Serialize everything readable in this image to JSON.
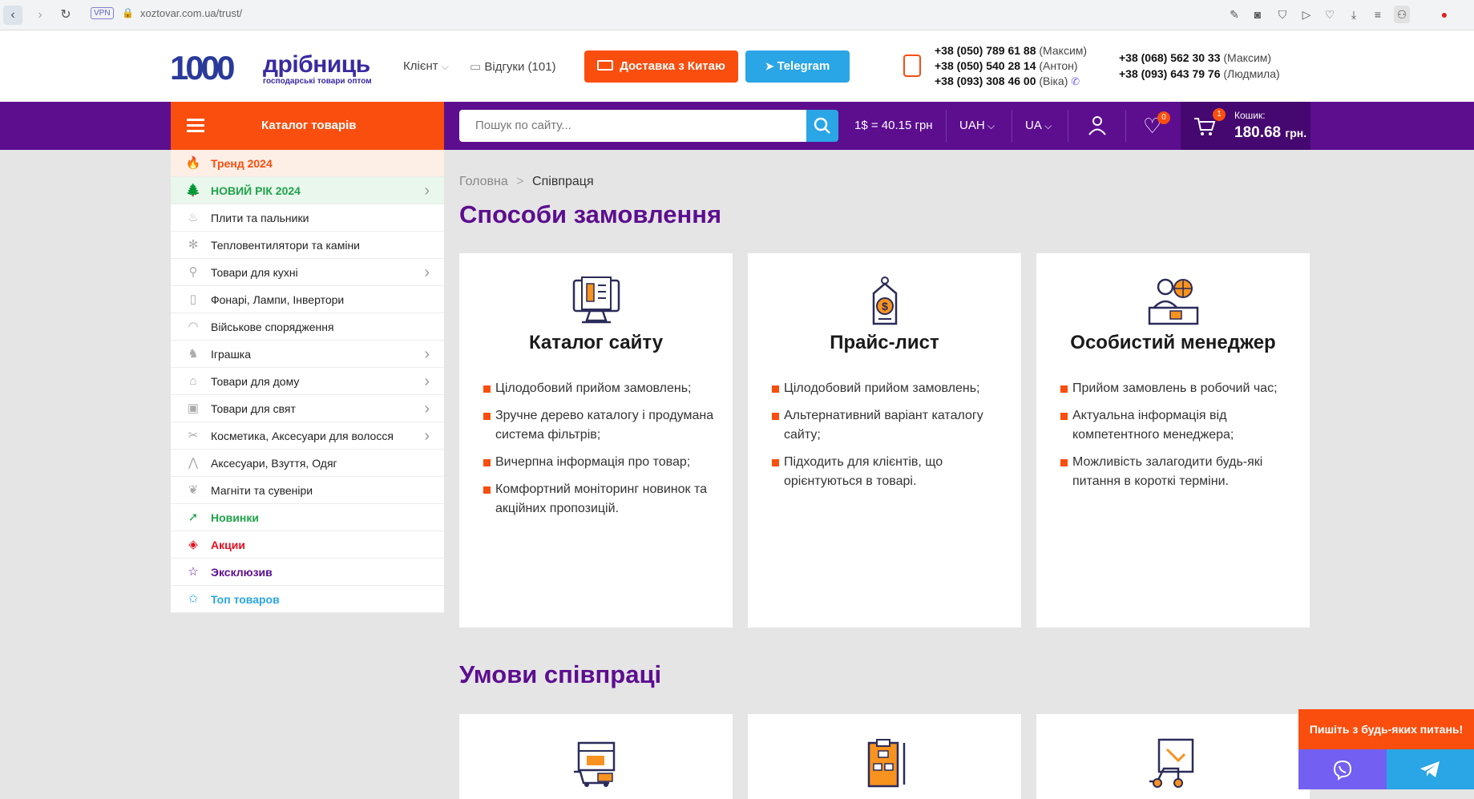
{
  "browser": {
    "url": "xoztovar.com.ua/trust/",
    "vpn_label": "VPN"
  },
  "header": {
    "logo_number": "1000",
    "logo_name": "дрібниць",
    "logo_tagline": "господарські товари оптом",
    "client_label": "Клієнт",
    "reviews_label": "Відгуки (101)",
    "china_button": "Доставка з Китаю",
    "telegram_button": "Telegram",
    "phones_left": [
      {
        "number": "+38 (050) 789 61 88",
        "name": "(Максим)"
      },
      {
        "number": "+38 (050) 540 28 14",
        "name": "(Антон)"
      },
      {
        "number": "+38 (093) 308 46 00",
        "name": "(Віка)"
      }
    ],
    "phones_right": [
      {
        "number": "+38 (068) 562 30 33",
        "name": "(Максим)"
      },
      {
        "number": "+38 (093) 643 79 76",
        "name": "(Людмила)"
      }
    ]
  },
  "navbar": {
    "catalog_label": "Каталог товарів",
    "search_placeholder": "Пошук по сайту...",
    "rate": "1$ = 40.15 грн",
    "currency": "UAH",
    "language": "UA",
    "wishlist_count": "0",
    "cart_count": "1",
    "cart_label": "Кошик:",
    "cart_total": "180.68",
    "cart_currency": "грн."
  },
  "sidebar": {
    "items": [
      {
        "label": "Тренд 2024",
        "icon": "fire-icon",
        "glyph": "🔥",
        "color": "#f94e0e",
        "bold": true,
        "bg": "#fdeee6",
        "chevron": false
      },
      {
        "label": "НОВИЙ РІК 2024",
        "icon": "tree-icon",
        "glyph": "🌲",
        "color": "#1fa34a",
        "bold": true,
        "bg": "#e9f7ec",
        "chevron": true
      },
      {
        "label": "Плити та пальники",
        "icon": "flame-icon",
        "glyph": "♨",
        "color": "#222",
        "bold": false,
        "bg": "#fff",
        "chevron": false
      },
      {
        "label": "Тепловентилятори та каміни",
        "icon": "fan-icon",
        "glyph": "✻",
        "color": "#222",
        "bold": false,
        "bg": "#fff",
        "chevron": false
      },
      {
        "label": "Товари для кухні",
        "icon": "kitchen-icon",
        "glyph": "⚲",
        "color": "#222",
        "bold": false,
        "bg": "#fff",
        "chevron": true
      },
      {
        "label": "Фонарі, Лампи, Інвертори",
        "icon": "flashlight-icon",
        "glyph": "▯",
        "color": "#222",
        "bold": false,
        "bg": "#fff",
        "chevron": false
      },
      {
        "label": "Військове спорядження",
        "icon": "helmet-icon",
        "glyph": "◠",
        "color": "#222",
        "bold": false,
        "bg": "#fff",
        "chevron": false
      },
      {
        "label": "Іграшка",
        "icon": "toy-icon",
        "glyph": "♞",
        "color": "#222",
        "bold": false,
        "bg": "#fff",
        "chevron": true
      },
      {
        "label": "Товари для дому",
        "icon": "house-icon",
        "glyph": "⌂",
        "color": "#222",
        "bold": false,
        "bg": "#fff",
        "chevron": true
      },
      {
        "label": "Товари для свят",
        "icon": "gift-icon",
        "glyph": "▣",
        "color": "#222",
        "bold": false,
        "bg": "#fff",
        "chevron": true
      },
      {
        "label": "Косметика, Аксесуари для волосся",
        "icon": "scissors-icon",
        "glyph": "✂",
        "color": "#222",
        "bold": false,
        "bg": "#fff",
        "chevron": true
      },
      {
        "label": "Аксесуари, Взуття, Одяг",
        "icon": "hanger-icon",
        "glyph": "⋀",
        "color": "#222",
        "bold": false,
        "bg": "#fff",
        "chevron": false
      },
      {
        "label": "Магніти та сувеніри",
        "icon": "souvenir-icon",
        "glyph": "❦",
        "color": "#222",
        "bold": false,
        "bg": "#fff",
        "chevron": false
      },
      {
        "label": "Новинки",
        "icon": "arrow-icon",
        "glyph": "➚",
        "color": "#1fa34a",
        "bold": true,
        "bg": "#fff",
        "chevron": false
      },
      {
        "label": "Акции",
        "icon": "tag-icon",
        "glyph": "◈",
        "color": "#e5101f",
        "bold": true,
        "bg": "#fff",
        "chevron": false
      },
      {
        "label": "Эксклюзив",
        "icon": "star-icon",
        "glyph": "☆",
        "color": "#5c0e8f",
        "bold": true,
        "bg": "#fff",
        "chevron": false
      },
      {
        "label": "Топ товаров",
        "icon": "top-star-icon",
        "glyph": "✩",
        "color": "#2aa5e5",
        "bold": true,
        "bg": "#fff",
        "chevron": false
      }
    ]
  },
  "breadcrumb": {
    "home": "Головна",
    "separator": ">",
    "current": "Співпраця"
  },
  "sections": {
    "order_methods_title": "Способи замовлення",
    "cooperation_title": "Умови співпраці"
  },
  "cards": [
    {
      "title": "Каталог сайту",
      "icon": "monitor-catalog-icon",
      "items": [
        "Цілодобовий прийом замовлень;",
        "Зручне дерево каталогу і продумана система фільтрів;",
        "Вичерпна інформація про товар;",
        "Комфортний моніторинг новинок та акційних пропозицій."
      ]
    },
    {
      "title": "Прайс-лист",
      "icon": "price-tag-icon",
      "items": [
        "Цілодобовий прийом замовлень;",
        "Альтернативний варіант каталогу сайту;",
        "Підходить для клієнтів, що орієнтуються в товарі."
      ]
    },
    {
      "title": "Особистий менеджер",
      "icon": "manager-icon",
      "items": [
        "Прийом замовлень в робочий час;",
        "Актуальна інформація від компетентного менеджера;",
        "Можливість залагодити будь-які питання в короткі терміни."
      ]
    }
  ],
  "cooperation_icons": [
    "calendar-cart-icon",
    "clipboard-scheme-icon",
    "delivery-icon"
  ],
  "chat": {
    "title": "Пишіть з будь-яких питань!"
  },
  "colors": {
    "purple": "#5c0e8f",
    "orange": "#f94e0e",
    "blue": "#2aa5e5",
    "viber": "#7360f2"
  }
}
